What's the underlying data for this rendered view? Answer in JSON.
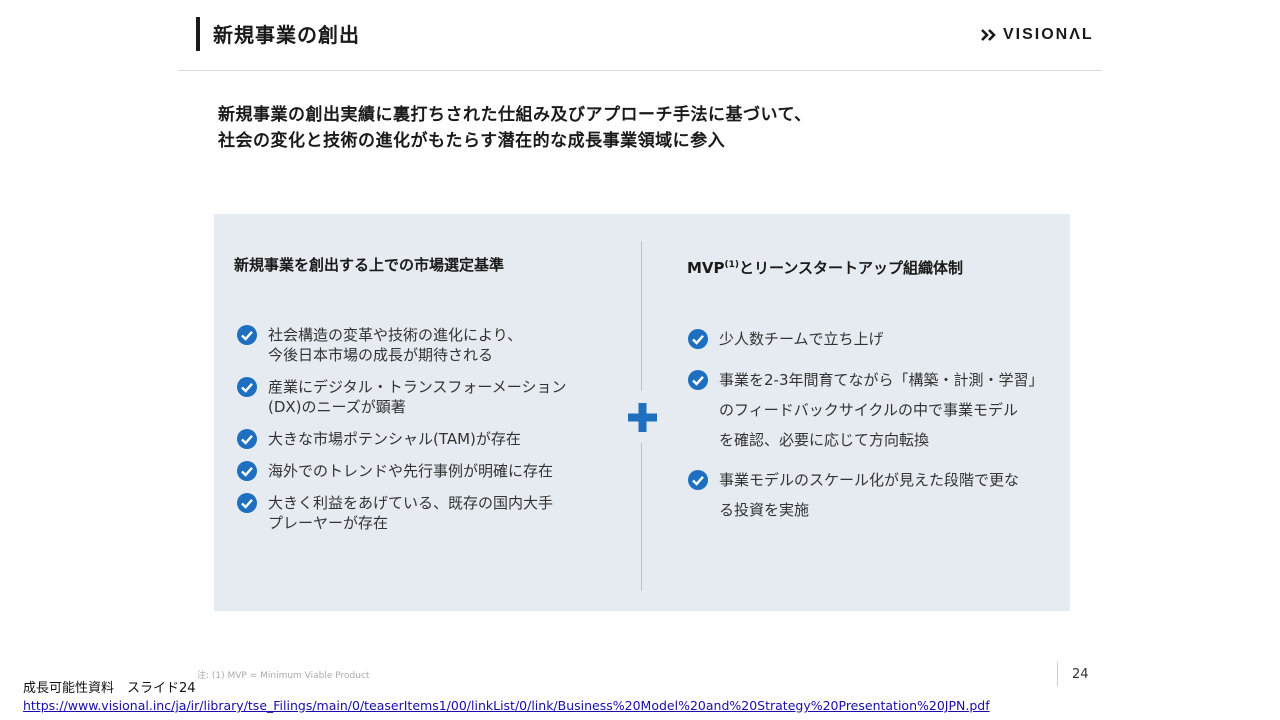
{
  "header": {
    "title": "新規事業の創出",
    "logo_text": "VISIONΛL",
    "logo_icon": "double-chevron-right-icon"
  },
  "lead": {
    "line1": "新規事業の創出実績に裏打ちされた仕組み及びアプローチ手法に基づいて、",
    "line2": "社会の変化と技術の進化がもたらす潜在的な成長事業領域に参入"
  },
  "left_column": {
    "heading": "新規事業を創出する上での市場選定基準",
    "items": [
      {
        "line1": "社会構造の変革や技術の進化により、",
        "line2": "今後日本市場の成長が期待される"
      },
      {
        "line1": "産業にデジタル・トランスフォーメーション",
        "line2": "(DX)のニーズが顕著"
      },
      {
        "line1": "大きな市場ポテンシャル(TAM)が存在",
        "line2": ""
      },
      {
        "line1": "海外でのトレンドや先行事例が明確に存在",
        "line2": ""
      },
      {
        "line1": "大きく利益をあげている、既存の国内大手",
        "line2": "プレーヤーが存在"
      }
    ]
  },
  "right_column": {
    "heading_prefix": "MVP",
    "heading_sup": "(1)",
    "heading_suffix": "とリーンスタートアップ組織体制",
    "items": [
      {
        "line1": "少人数チームで立ち上げ",
        "line2": "",
        "line3": ""
      },
      {
        "line1": "事業を2-3年間育てながら「構築・計測・学習」",
        "line2": "のフィードバックサイクルの中で事業モデル",
        "line3": "を確認、必要に応じて方向転換"
      },
      {
        "line1": "事業モデルのスケール化が見えた段階で更な",
        "line2": "る投資を実施",
        "line3": ""
      }
    ]
  },
  "footnote": "注: (1) MVP = Minimum Viable Product",
  "page_number": "24",
  "caption": "成長可能性資料　スライド24",
  "source_url": "https://www.visional.inc/ja/ir/library/tse_Filings/main/0/teaserItems1/00/linkList/0/link/Business%20Model%20and%20Strategy%20Presentation%20JPN.pdf",
  "colors": {
    "accent_blue": "#1e6fc0",
    "panel_bg": "#e6ebf2",
    "link": "#1a0dab"
  },
  "icons": {
    "check": "check-circle-icon",
    "plus": "plus-icon"
  }
}
